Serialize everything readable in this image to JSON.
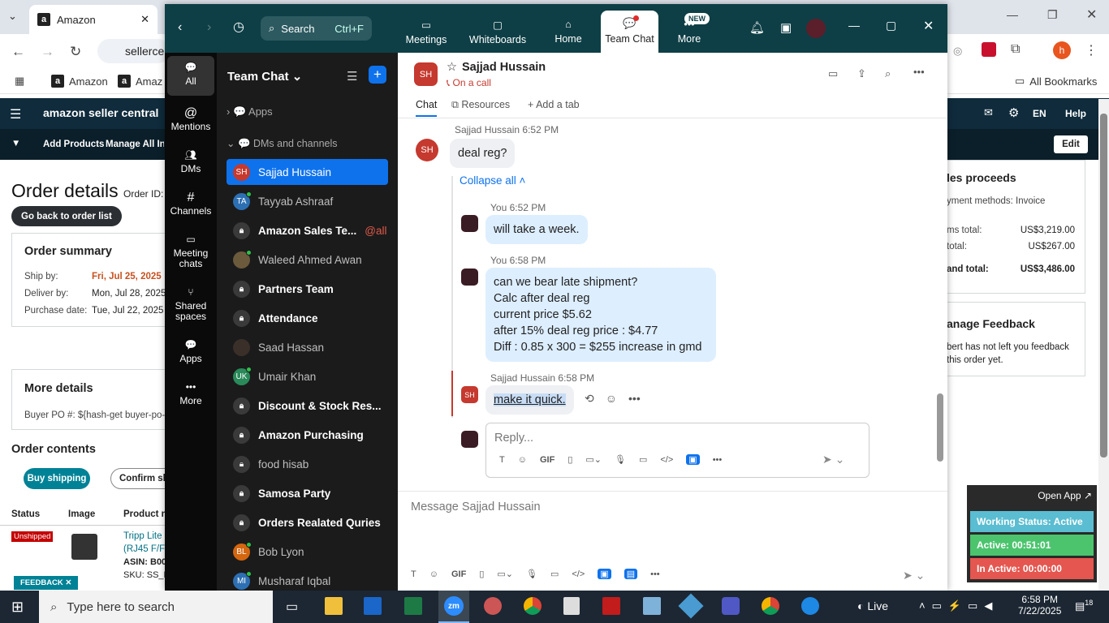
{
  "browser": {
    "tab_title": "Amazon",
    "url": "sellerce",
    "bookmarks": [
      "Amazon",
      "Amaz"
    ],
    "all_bookmarks": "All Bookmarks",
    "profile_initial": "h"
  },
  "seller": {
    "logo": "amazon seller central",
    "nav": [
      "Add Products",
      "Manage All Inv"
    ],
    "lang": "EN",
    "help": "Help",
    "edit": "Edit",
    "title": "Order details",
    "order_id_label": "Order ID:",
    "back": "Go back to order list",
    "summary": {
      "title": "Order summary",
      "rows": [
        {
          "label": "Ship by:",
          "value": "Fri, Jul 25, 2025"
        },
        {
          "label": "Deliver by:",
          "value": "Mon, Jul 28, 2025"
        },
        {
          "label": "Purchase date:",
          "value": "Tue, Jul 22, 2025"
        }
      ]
    },
    "more": {
      "title": "More details",
      "buyer_po": "Buyer PO #: ${hash-get buyer-po-"
    },
    "contents": {
      "title": "Order contents",
      "buy": "Buy shipping",
      "confirm": "Confirm shi"
    },
    "table": {
      "headers": [
        "Status",
        "Image",
        "Product n"
      ],
      "status": "Unshipped",
      "product": "Tripp Lite",
      "product2": "(RJ45 F/F",
      "asin": "ASIN: B00",
      "sku": "SKU: SS_D"
    },
    "feedback_tab": "FEEDBACK",
    "proceeds": {
      "title": "les proceeds",
      "method": "yment methods: Invoice",
      "rows": [
        {
          "label": "ms total:",
          "value": "US$3,219.00"
        },
        {
          "label": "total:",
          "value": "US$267.00"
        },
        {
          "label": "and total:",
          "value": "US$3,486.00"
        }
      ]
    },
    "manage_feedback": {
      "title": "anage Feedback",
      "text1": "bert has not left you feedback",
      "text2": "this order yet."
    }
  },
  "zoom": {
    "search": "Search",
    "search_shortcut": "Ctrl+F",
    "nav": [
      "Meetings",
      "Whiteboards",
      "Home",
      "Team Chat",
      "More"
    ],
    "new_badge": "NEW",
    "rail": [
      "All",
      "Mentions",
      "DMs",
      "Channels",
      "Meeting chats",
      "Shared spaces",
      "Apps",
      "More"
    ],
    "list_title": "Team Chat",
    "apps": "Apps",
    "dms_header": "DMs and channels",
    "items": [
      {
        "name": "Sajjad Hussain",
        "init": "SH",
        "color": "#c5392e",
        "bold": false,
        "selected": true,
        "online": false
      },
      {
        "name": "Tayyab Ashraaf",
        "init": "TA",
        "color": "#2d6fb3",
        "bold": false,
        "online": true
      },
      {
        "name": "Amazon Sales Te...",
        "lock": true,
        "bold": true,
        "tag": "@all"
      },
      {
        "name": "Waleed Ahmed Awan",
        "init": "",
        "color": "#6b5a3c",
        "bold": false,
        "online": true
      },
      {
        "name": "Partners Team",
        "lock": true,
        "bold": true
      },
      {
        "name": "Attendance",
        "lock": true,
        "bold": true
      },
      {
        "name": "Saad Hassan",
        "init": "",
        "color": "#3b2f2a",
        "bold": false
      },
      {
        "name": "Umair Khan",
        "init": "UK",
        "color": "#2a8a5a",
        "bold": false,
        "online": true
      },
      {
        "name": "Discount & Stock Res...",
        "lock": true,
        "bold": true
      },
      {
        "name": "Amazon Purchasing",
        "lock": true,
        "bold": true
      },
      {
        "name": "food hisab",
        "lock": true,
        "bold": false
      },
      {
        "name": "Samosa Party",
        "lock": true,
        "bold": true
      },
      {
        "name": "Orders Realated Quries",
        "lock": true,
        "bold": true
      },
      {
        "name": "Bob Lyon",
        "init": "BL",
        "color": "#d4660f",
        "bold": false,
        "online": true
      },
      {
        "name": "Musharaf Iqbal",
        "init": "MI",
        "color": "#2d6fb3",
        "bold": false,
        "online": true
      }
    ],
    "chat": {
      "contact": "Sajjad Hussain",
      "initials": "SH",
      "status": "On a call",
      "tabs": [
        "Chat",
        "Resources",
        "Add a tab"
      ],
      "collapse": "Collapse all",
      "messages": [
        {
          "author": "Sajjad Hussain",
          "time": "6:52 PM",
          "lines": [
            "deal reg?"
          ]
        },
        {
          "author": "You",
          "time": "6:52 PM",
          "lines": [
            "will take a week."
          ]
        },
        {
          "author": "You",
          "time": "6:58 PM",
          "lines": [
            "can we bear late shipment?",
            "Calc after deal reg",
            "current price $5.62",
            "after 15% deal reg price : $4.77",
            "Diff : 0.85 x 300 = $255 increase in gmd"
          ]
        },
        {
          "author": "Sajjad Hussain",
          "time": "6:58 PM",
          "lines": [
            "make it quick."
          ]
        }
      ],
      "reply_placeholder": "Reply...",
      "message_placeholder": "Message Sajjad Hussain",
      "gif": "GIF"
    }
  },
  "widget": {
    "open": "Open App",
    "status": "Working Status: Active",
    "active": "Active: 00:51:01",
    "inactive": "In Active: 00:00:00"
  },
  "taskbar": {
    "search": "Type here to search",
    "live": "Live",
    "time": "6:58 PM",
    "date": "7/22/2025",
    "notif": "18"
  }
}
